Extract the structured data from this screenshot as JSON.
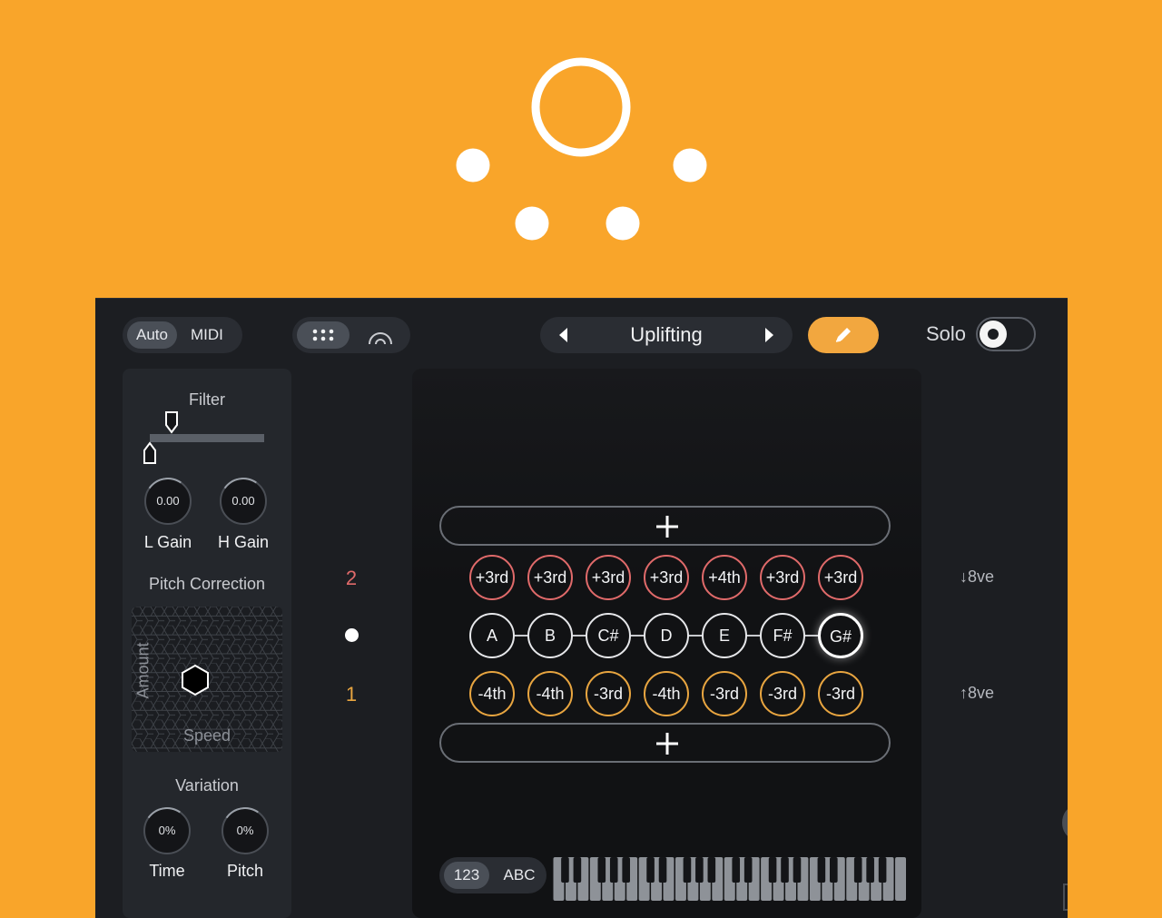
{
  "header": {
    "mode_options": [
      "Auto",
      "MIDI"
    ],
    "view_icons": [
      "grid-dots-icon",
      "arc-icon"
    ],
    "preset_name": "Uplifting",
    "solo_label": "Solo"
  },
  "left_panel": {
    "filter_label": "Filter",
    "l_gain_value": "0.00",
    "l_gain_label": "L Gain",
    "h_gain_value": "0.00",
    "h_gain_label": "H Gain",
    "pitch_correction_label": "Pitch Correction",
    "amount_label": "Amount",
    "speed_label": "Speed",
    "variation_label": "Variation",
    "time_value": "0%",
    "time_label": "Time",
    "pitch_value": "0%",
    "pitch_label": "Pitch"
  },
  "side_labels": {
    "top": "2",
    "bottom": "1"
  },
  "grid": {
    "upper_intervals": [
      "+3rd",
      "+3rd",
      "+3rd",
      "+3rd",
      "+4th",
      "+3rd",
      "+3rd"
    ],
    "notes": [
      "A",
      "B",
      "C#",
      "D",
      "E",
      "F#",
      "G#"
    ],
    "lower_intervals": [
      "-4th",
      "-4th",
      "-3rd",
      "-4th",
      "-3rd",
      "-3rd",
      "-3rd"
    ]
  },
  "octave": {
    "down": "8ve",
    "up": "8ve"
  },
  "keyboard": {
    "options": [
      "123",
      "ABC"
    ]
  },
  "colors": {
    "background": "#F9A52A",
    "accent": "#F2A73F",
    "upper": "#E06A6A",
    "lower": "#E8A540"
  }
}
